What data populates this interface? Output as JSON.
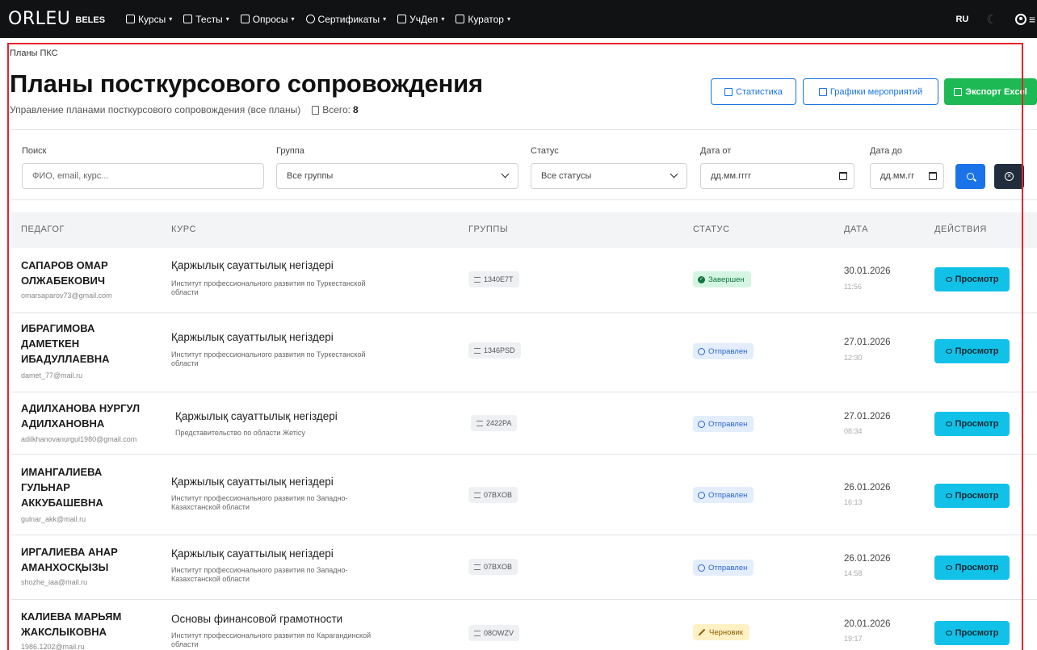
{
  "nav": {
    "brand": "ORLEU",
    "brand_sub": "BELES",
    "menu": [
      {
        "label": "Курсы",
        "icon": "book-icon"
      },
      {
        "label": "Тесты",
        "icon": "list-icon"
      },
      {
        "label": "Опросы",
        "icon": "poll-icon"
      },
      {
        "label": "Сертификаты",
        "icon": "certificate-icon"
      },
      {
        "label": "УчДеп",
        "icon": "building-icon"
      },
      {
        "label": "Куратор",
        "icon": "chart-icon"
      }
    ],
    "lang": "RU"
  },
  "header": {
    "breadcrumb": "Планы ПКС",
    "title": "Планы посткурсового сопровождения",
    "subtitle": "Управление планами посткурсового сопровождения (все планы)",
    "total_label": "Всего:",
    "total_value": "8",
    "btn_stats": "Статистика",
    "btn_schedule": "Графики мероприятий",
    "btn_export": "Экспорт Excel"
  },
  "filters": {
    "search_label": "Поиск",
    "search_placeholder": "ФИО, email, курс...",
    "group_label": "Группа",
    "group_value": "Все группы",
    "status_label": "Статус",
    "status_value": "Все статусы",
    "date_from_label": "Дата от",
    "date_from_value": "дд.мм.гггг",
    "date_to_label": "Дата до",
    "date_to_value": "дд.мм.гг"
  },
  "table": {
    "headers": [
      "ПЕДАГОГ",
      "КУРС",
      "ГРУППЫ",
      "СТАТУС",
      "ДАТА",
      "ДЕЙСТВИЯ"
    ],
    "view_label": "Просмотр",
    "rows": [
      {
        "name": "САПАРОВ ОМАР ОЛЖАБЕКОВИЧ",
        "name_l1": "САПАРОВ ОМАР",
        "name_l2": "ОЛЖАБЕКОВИЧ",
        "name_l3": "",
        "email": "omarsaparov73@gmail.com",
        "course": "Қаржылық сауаттылық негіздері",
        "org_l1": "Институт профессионального развития по Туркестанской",
        "org_l2": "области",
        "group": "1340E7T",
        "status": "Завершен",
        "status_kind": "done",
        "date": "30.01.2026",
        "time": "11:56"
      },
      {
        "name": "ИБРАГИМОВА ДАМЕТКЕН ИБАДУЛЛАЕВНА",
        "name_l1": "ИБРАГИМОВА",
        "name_l2": "ДАМЕТКЕН",
        "name_l3": "ИБАДУЛЛАЕВНА",
        "email": "damet_77@mail.ru",
        "course": "Қаржылық сауаттылық негіздері",
        "org_l1": "Институт профессионального развития по Туркестанской",
        "org_l2": "области",
        "group": "1346PSD",
        "status": "Отправлен",
        "status_kind": "sent",
        "date": "27.01.2026",
        "time": "12:30"
      },
      {
        "name": "АДИЛХАНОВА НУРГУЛ АДИЛХАНОВНА",
        "name_l1": "АДИЛХАНОВА НУРГУЛ",
        "name_l2": "АДИЛХАНОВНА",
        "name_l3": "",
        "email": "adilkhanovanurgul1980@gmail.com",
        "course": "Қаржылық сауаттылық негіздері",
        "org_l1": "Представительство по области Жетісу",
        "org_l2": "",
        "group": "2422PA",
        "status": "Отправлен",
        "status_kind": "sent",
        "date": "27.01.2026",
        "time": "08:34"
      },
      {
        "name": "ИМАНГАЛИЕВА ГУЛЬНАР АККУБАШЕВНА",
        "name_l1": "ИМАНГАЛИЕВА",
        "name_l2": "ГУЛЬНАР",
        "name_l3": "АККУБАШЕВНА",
        "email": "gulnar_akk@mail.ru",
        "course": "Қаржылық сауаттылық негіздері",
        "org_l1": "Институт профессионального развития по Западно-",
        "org_l2": "Казахстанской области",
        "group": "07BXOB",
        "status": "Отправлен",
        "status_kind": "sent",
        "date": "26.01.2026",
        "time": "16:13"
      },
      {
        "name": "ИРГАЛИЕВА АНАР АМАНХОСҚЫЗЫ",
        "name_l1": "ИРГАЛИЕВА АНАР",
        "name_l2": "АМАНХОСҚЫЗЫ",
        "name_l3": "",
        "email": "shozhe_iaa@mail.ru",
        "course": "Қаржылық сауаттылық негіздері",
        "org_l1": "Институт профессионального развития по Западно-",
        "org_l2": "Казахстанской области",
        "group": "07BXOB",
        "status": "Отправлен",
        "status_kind": "sent",
        "date": "26.01.2026",
        "time": "14:58"
      },
      {
        "name": "КАЛИЕВА МАРЬЯМ ЖАКСЛЫКОВНА",
        "name_l1": "КАЛИЕВА МАРЬЯМ",
        "name_l2": "ЖАКСЛЫКОВНА",
        "name_l3": "",
        "email": "1986.1202@mail.ru",
        "course": "Основы финансовой грамотности",
        "org_l1": "Институт профессионального развития по Карагандинской",
        "org_l2": "области",
        "group": "08OWZV",
        "status": "Черновик",
        "status_kind": "draft",
        "date": "20.01.2026",
        "time": "19:17"
      }
    ]
  },
  "colors": {
    "navbar": "#111214",
    "primary": "#1a73e8",
    "success": "#1db954",
    "info": "#12c1e8",
    "dark": "#1f2d3d",
    "selection": "#e8232d"
  }
}
